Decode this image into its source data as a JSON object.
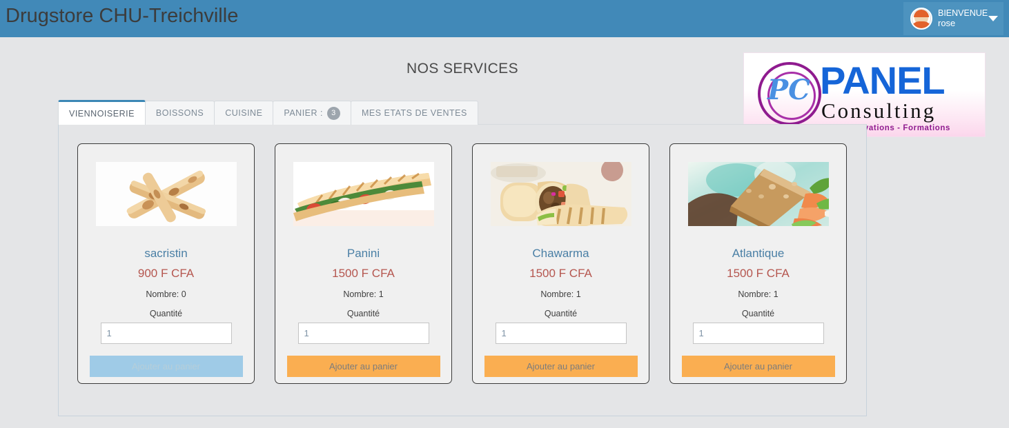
{
  "header": {
    "brand_title": "Drugstore CHU-Treichville",
    "user": {
      "greeting": "BIENVENUE",
      "name": "rose",
      "avatar_icon": "user-avatar-icon",
      "caret_icon": "chevron-down-icon"
    },
    "background_color": "#4189b8",
    "title_color": "#3c3c3c"
  },
  "page": {
    "heading": "NOS SERVICES",
    "background_color": "#e4e5e7"
  },
  "logo": {
    "monogram": "PC",
    "word": "PANEL",
    "subword": "Consulting",
    "tagline": "Recherches  -  Innovations  -  Formations",
    "word_color": "#1565d8",
    "accent_color": "#8f1b8f"
  },
  "tabs": [
    {
      "label": "VIENNOISERIE",
      "active": true,
      "badge": null
    },
    {
      "label": "BOISSONS",
      "active": false,
      "badge": null
    },
    {
      "label": "CUISINE",
      "active": false,
      "badge": null
    },
    {
      "label": "PANIER :",
      "active": false,
      "badge": "3"
    },
    {
      "label": "MES ETATS DE VENTES",
      "active": false,
      "badge": null
    }
  ],
  "products": [
    {
      "name": "sacristin",
      "price": "900 F CFA",
      "count_label": "Nombre: 0",
      "qty_label": "Quantité",
      "qty_value": "1",
      "button_label": "Ajouter au panier",
      "button_enabled": false,
      "image_name": "sacristin-pastry-photo"
    },
    {
      "name": "Panini",
      "price": "1500 F CFA",
      "count_label": "Nombre: 1",
      "qty_label": "Quantité",
      "qty_value": "1",
      "button_label": "Ajouter au panier",
      "button_enabled": true,
      "image_name": "panini-sandwich-photo"
    },
    {
      "name": "Chawarma",
      "price": "1500 F CFA",
      "count_label": "Nombre: 1",
      "qty_label": "Quantité",
      "qty_value": "1",
      "button_label": "Ajouter au panier",
      "button_enabled": true,
      "image_name": "chawarma-wrap-photo"
    },
    {
      "name": "Atlantique",
      "price": "1500 F CFA",
      "count_label": "Nombre: 1",
      "qty_label": "Quantité",
      "qty_value": "1",
      "button_label": "Ajouter au panier",
      "button_enabled": true,
      "image_name": "atlantique-sandwich-photo"
    }
  ],
  "colors": {
    "accent_blue": "#4189b8",
    "button_orange": "#faae51",
    "button_disabled": "#9fcbe7",
    "price_red": "#b5564f",
    "title_blue": "#4a7fa5"
  }
}
